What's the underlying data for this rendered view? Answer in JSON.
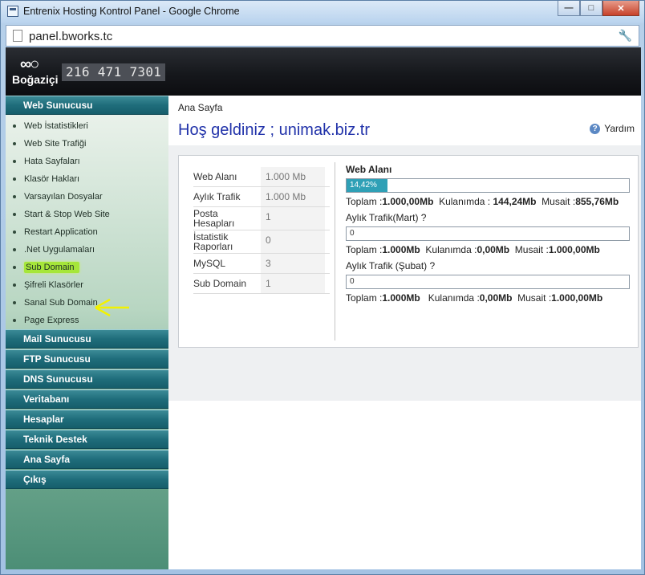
{
  "window": {
    "title": "Entrenix Hosting Kontrol Panel - Google Chrome",
    "url": "panel.bworks.tc"
  },
  "header": {
    "logo_text": "Boğaziçi",
    "phone": "216 471 7301"
  },
  "sidebar": {
    "web_section": "Web Sunucusu",
    "web_items": [
      "Web İstatistikleri",
      "Web Site Trafiği",
      "Hata Sayfaları",
      "Klasör Hakları",
      "Varsayılan Dosyalar",
      "Start & Stop Web Site",
      "Restart Application",
      ".Net Uygulamaları",
      "Sub Domain",
      "Şifreli Klasörler",
      "Sanal Sub Domain",
      "Page Express"
    ],
    "selected_index": 8,
    "sections": [
      "Mail Sunucusu",
      "FTP Sunucusu",
      "DNS Sunucusu",
      "Veritabanı",
      "Hesaplar",
      "Teknik Destek",
      "Ana Sayfa",
      "Çıkış"
    ]
  },
  "main": {
    "breadcrumb": "Ana Sayfa",
    "title": "Hoş geldiniz ; unimak.biz.tr",
    "help_label": "Yardım"
  },
  "stats": [
    {
      "label": "Web Alanı",
      "value": "1.000 Mb"
    },
    {
      "label": "Aylık Trafik",
      "value": "1.000 Mb"
    },
    {
      "label": "Posta Hesapları",
      "value": "1"
    },
    {
      "label": "İstatistik Raporları",
      "value": "0"
    },
    {
      "label": "MySQL",
      "value": "3"
    },
    {
      "label": "Sub Domain",
      "value": "1"
    }
  ],
  "usage": {
    "web_title": "Web Alanı",
    "web_bar": {
      "fraction": 0.1442,
      "label": "14,42%"
    },
    "web_total_label": "Toplam :",
    "web_total": "1.000,00Mb",
    "web_used_label": "Kulanımda :",
    "web_used": "144,24Mb",
    "web_free_label": "Musait :",
    "web_free": "855,76Mb",
    "mart_title": "Aylık Trafik(Mart) ?",
    "mart_bar": {
      "fraction": 0,
      "label": "0"
    },
    "mart_total_label": "Toplam :",
    "mart_total": "1.000Mb",
    "mart_used_label": "Kulanımda :",
    "mart_used": "0,00Mb",
    "mart_free_label": "Musait :",
    "mart_free": "1.000,00Mb",
    "subat_title": "Aylık Trafik (Şubat) ?",
    "subat_bar": {
      "fraction": 0,
      "label": "0"
    },
    "subat_total_label": "Toplam :",
    "subat_total": "1.000Mb",
    "subat_used_label": "Kulanımda :",
    "subat_used": "0,00Mb",
    "subat_free_label": "Musait :",
    "subat_free": "1.000,00Mb"
  },
  "colors": {
    "highlight": "#a6e63a",
    "arrow": "#f2f200",
    "bar_fill": "#2fa0b6",
    "title_blue": "#2233aa"
  }
}
